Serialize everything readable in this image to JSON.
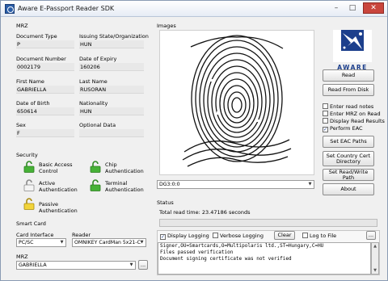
{
  "window": {
    "title": "Aware E-Passport Reader SDK"
  },
  "mrz_section": {
    "title": "MRZ",
    "fields": [
      {
        "label": "Document Type",
        "value": "P"
      },
      {
        "label": "Issuing State/Organization",
        "value": "HUN"
      },
      {
        "label": "Document Number",
        "value": "0002179"
      },
      {
        "label": "Date of Expiry",
        "value": "160206"
      },
      {
        "label": "First Name",
        "value": "GABRIELLA"
      },
      {
        "label": "Last Name",
        "value": "RUSORAN"
      },
      {
        "label": "Date of Birth",
        "value": "650614"
      },
      {
        "label": "Nationality",
        "value": "HUN"
      },
      {
        "label": "Sex",
        "value": "F"
      },
      {
        "label": "Optional Data",
        "value": ""
      }
    ]
  },
  "security": {
    "title": "Security",
    "items": [
      {
        "label": "Basic Access Control",
        "line1": "Basic Access",
        "line2": "Control",
        "icon": "lock-open-green-icon",
        "status_color": "#3a9a2e"
      },
      {
        "label": "Chip Authentication",
        "line1": "Chip",
        "line2": "Authentication",
        "icon": "lock-open-green-icon",
        "status_color": "#3a9a2e"
      },
      {
        "label": "Active Authentication",
        "line1": "Active",
        "line2": "Authentication",
        "icon": "lock-open-gray-icon",
        "status_color": "#9a9a9a"
      },
      {
        "label": "Terminal Authentication",
        "line1": "Terminal",
        "line2": "Authentication",
        "icon": "lock-open-green-icon",
        "status_color": "#3a9a2e"
      },
      {
        "label": "Passive Authentication",
        "line1": "Passive",
        "line2": "Authentication",
        "icon": "lock-open-yellow-icon",
        "status_color": "#e0c020"
      }
    ]
  },
  "smart_card": {
    "title": "Smart Card",
    "card_interface_label": "Card Interface",
    "card_interface_value": "PC/SC",
    "reader_label": "Reader",
    "reader_value": "OMNIKEY CardMan 5x21-C",
    "mrz_label": "MRZ",
    "mrz_value": "GABRIELLA",
    "browse_label": "..."
  },
  "images": {
    "title": "Images",
    "selected_dg": "DG3:0:0"
  },
  "right_panel": {
    "logo_text": "AWARE",
    "read_label": "Read",
    "read_from_disk_label": "Read From Disk",
    "options": [
      {
        "label": "Enter read notes",
        "checked": false
      },
      {
        "label": "Enter MRZ on Read",
        "checked": false
      },
      {
        "label": "Display Read Results",
        "checked": false
      },
      {
        "label": "Perform EAC",
        "checked": true
      }
    ],
    "set_eac_paths_label": "Set EAC Paths",
    "set_country_cert_line1": "Set Country Cert",
    "set_country_cert_line2": "Directory",
    "set_read_write_label": "Set Read/Write Path",
    "about_label": "About"
  },
  "status": {
    "title": "Status",
    "read_time": "Total read time: 23.47186 seconds",
    "progress": 0
  },
  "logging": {
    "display_logging_label": "Display Logging",
    "display_logging_checked": true,
    "verbose_logging_label": "Verbose Logging",
    "verbose_logging_checked": false,
    "clear_label": "Clear",
    "log_to_file_label": "Log to File",
    "log_to_file_checked": false,
    "browse_label": "...",
    "lines": [
      "Signer,OU=Smartcards,O=Multipolaris ltd.,ST=Hungary,C=HU",
      "Files passed verification",
      "Document signing certificate was not verified"
    ]
  }
}
